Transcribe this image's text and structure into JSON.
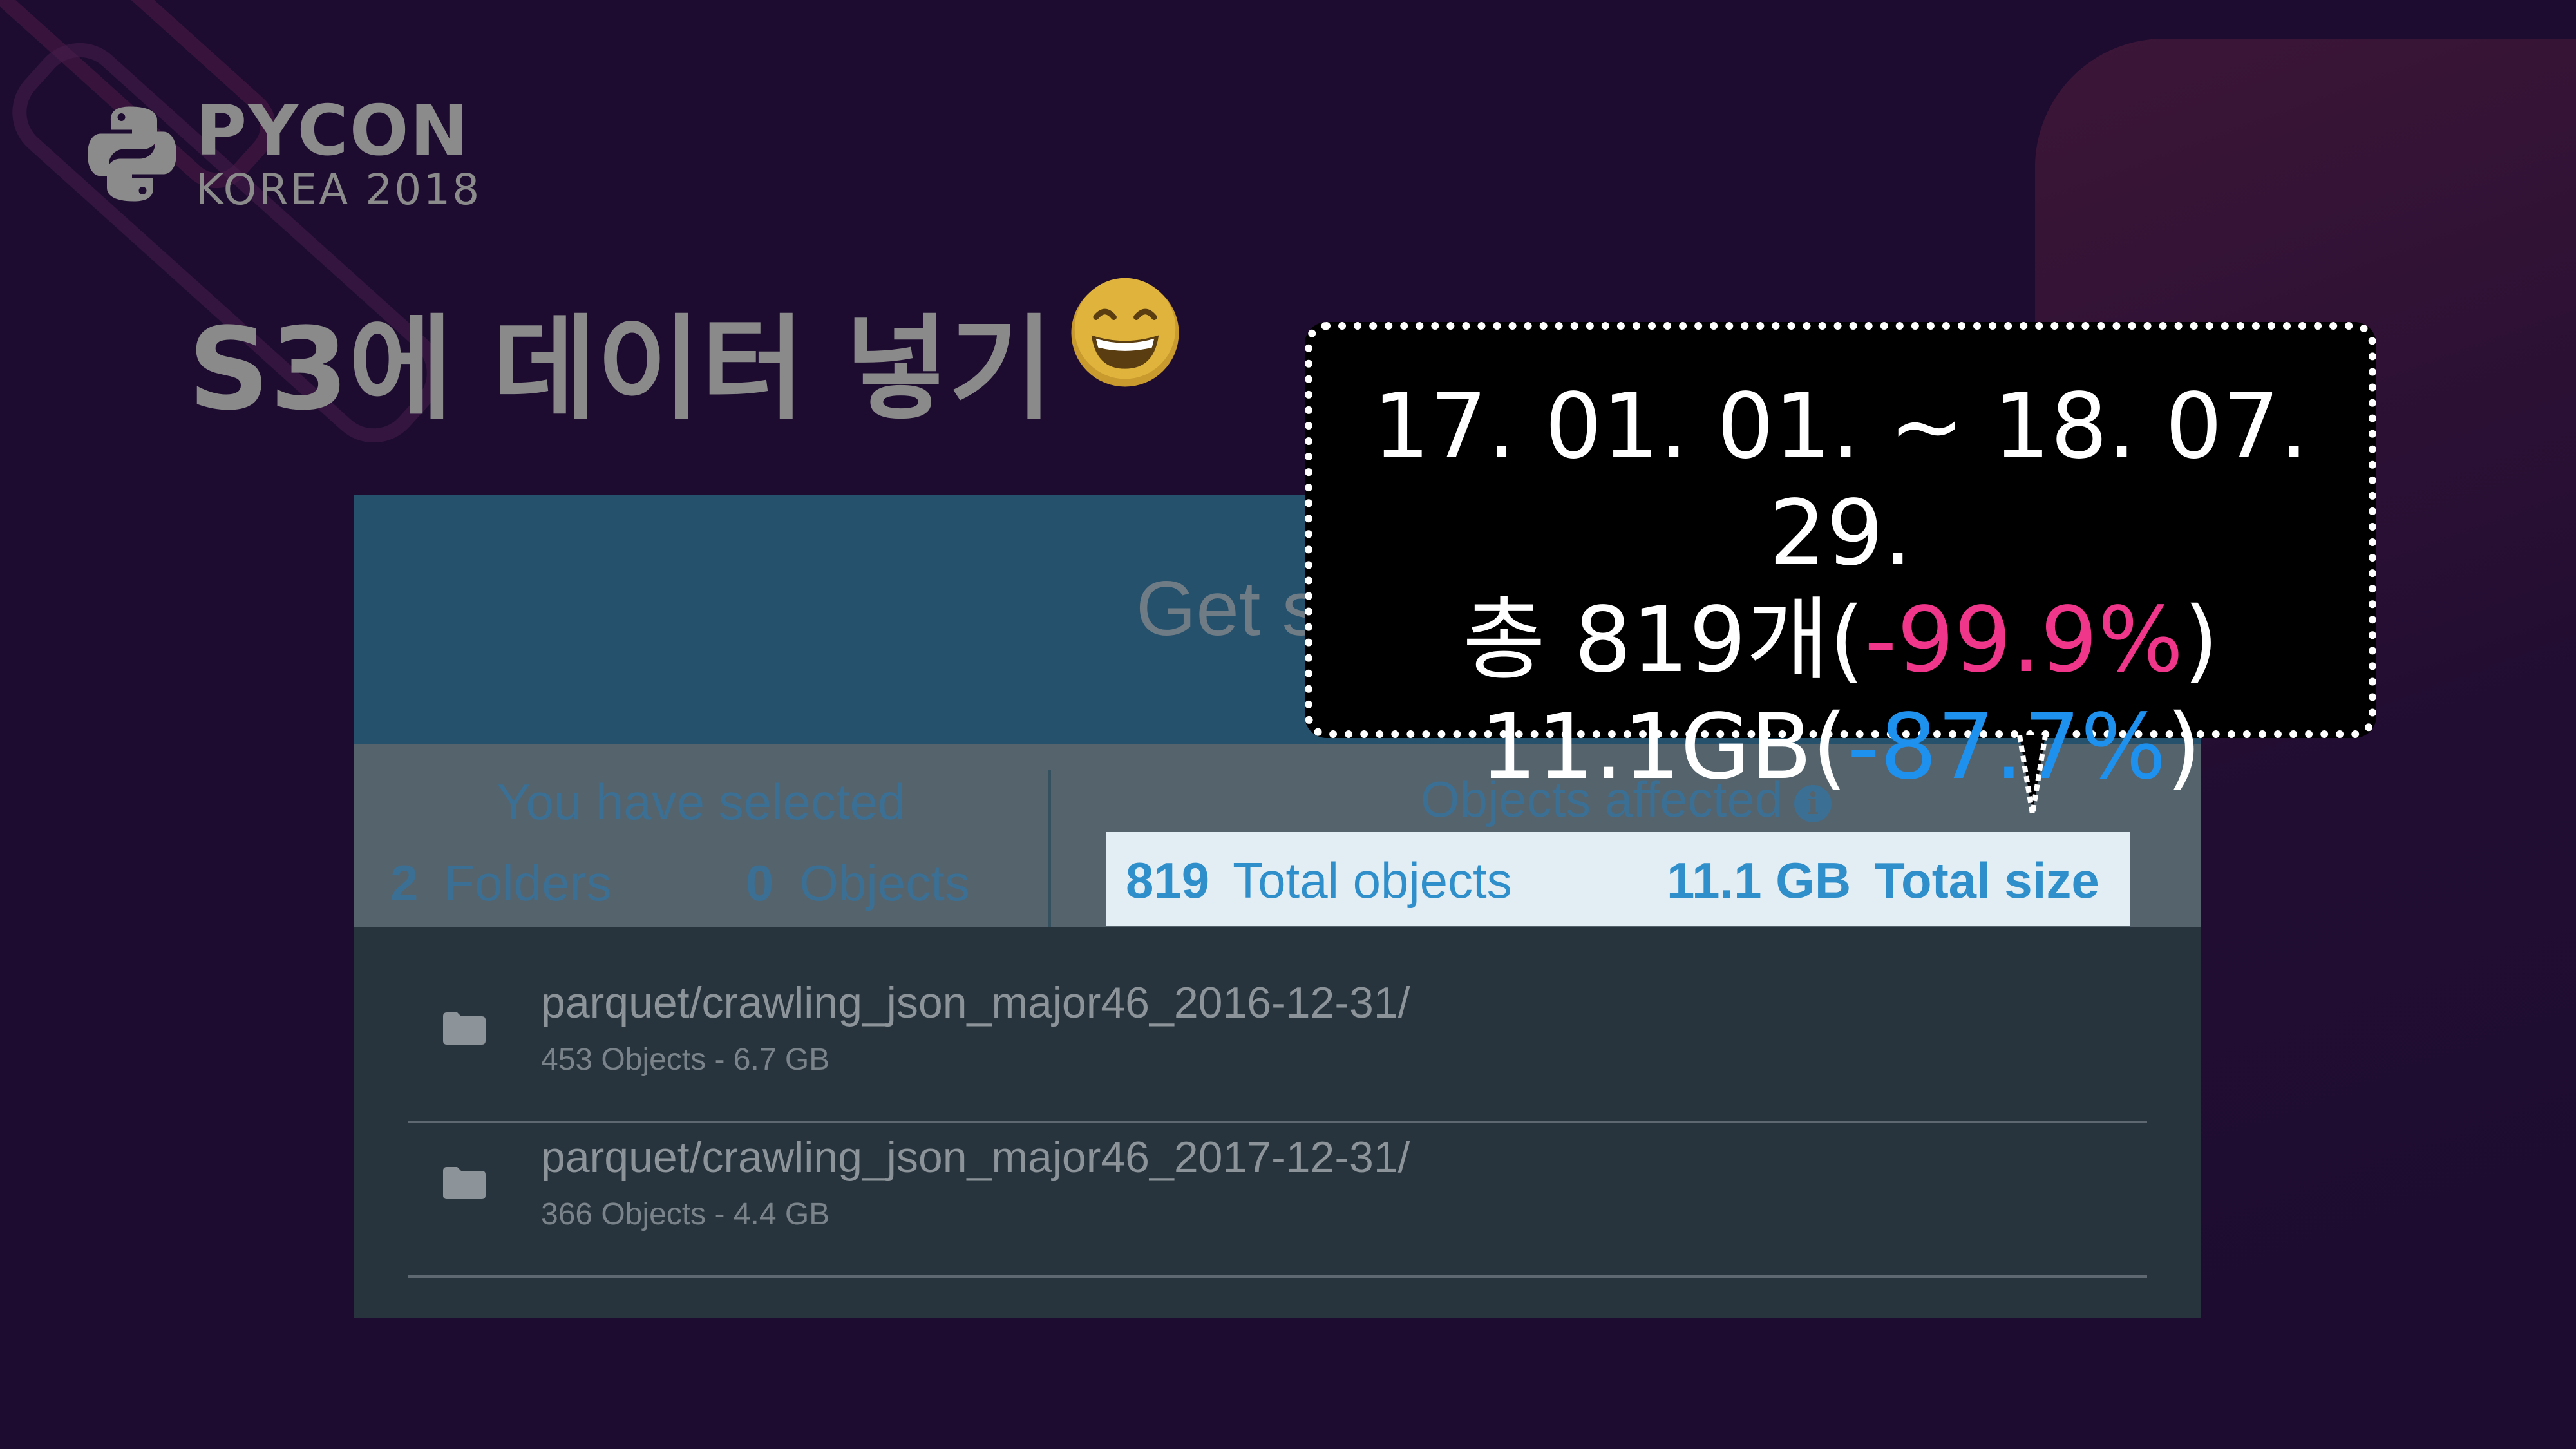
{
  "logo": {
    "title": "PYCON",
    "subtitle": "KOREA 2018"
  },
  "slide": {
    "title": "S3에 데이터 넣기",
    "emoji": "grinning-face-emoji"
  },
  "dialog": {
    "title": "Get size",
    "close_label": "×",
    "selected": {
      "label": "You have selected",
      "folders_count": "2",
      "folders_label": "Folders",
      "objects_count": "0",
      "objects_label": "Objects"
    },
    "affected": {
      "label": "Objects affected",
      "info_icon": "i",
      "total_objects_count": "819",
      "total_objects_label": "Total objects",
      "total_size_value": "11.1 GB",
      "total_size_label": "Total size"
    },
    "files": [
      {
        "name": "parquet/crawling_json_major46_2016-12-31/",
        "meta": "453 Objects - 6.7 GB"
      },
      {
        "name": "parquet/crawling_json_major46_2017-12-31/",
        "meta": "366 Objects - 4.4 GB"
      }
    ]
  },
  "callout": {
    "date_range": "17. 01. 01. ~ 18. 07. 29.",
    "count_prefix": "총 819개(",
    "count_change": "-99.9%",
    "count_suffix": ")",
    "size_prefix": "11.1GB(",
    "size_change": "-87.7%",
    "size_suffix": ")"
  },
  "colors": {
    "background": "#1d0c30",
    "header": "#25516d",
    "accent_blue": "#2f8fcb",
    "change_pink": "#f0368a",
    "change_blue": "#1e90ee"
  }
}
